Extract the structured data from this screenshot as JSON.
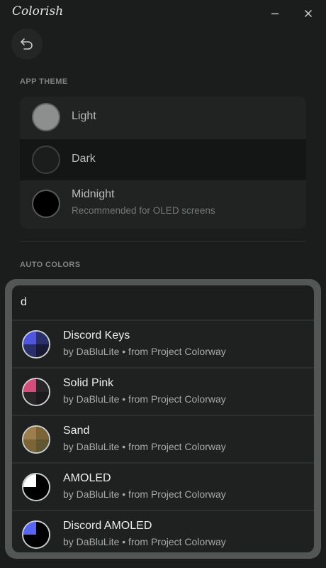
{
  "app": {
    "title": "Colorish",
    "minimize_icon": "minimize-icon",
    "close_icon": "close-icon",
    "back_icon": "undo-arrow-icon"
  },
  "sections": {
    "app_theme_label": "APP THEME",
    "auto_colors_label": "AUTO COLORS"
  },
  "themes": [
    {
      "name": "Light",
      "subtitle": "",
      "swatch": "#8d8f8e",
      "selected": false
    },
    {
      "name": "Dark",
      "subtitle": "",
      "swatch": "#1b1d1c",
      "selected": true
    },
    {
      "name": "Midnight",
      "subtitle": "Recommended for OLED screens",
      "swatch": "#000000",
      "selected": false
    }
  ],
  "search": {
    "value": "d"
  },
  "colorways": [
    {
      "name": "Discord Keys",
      "author": "by DaBluLite • from Project Colorway",
      "colors": [
        "#4e55e0",
        "#2a2f6b",
        "#2a2f6b",
        "#171936"
      ]
    },
    {
      "name": "Solid Pink",
      "author": "by DaBluLite • from Project Colorway",
      "colors": [
        "#d34d7d",
        "#2a2529",
        "#2a2529",
        "#1c1a1d"
      ]
    },
    {
      "name": "Sand",
      "author": "by DaBluLite • from Project Colorway",
      "colors": [
        "#9c7f4c",
        "#7c6436",
        "#7c6436",
        "#5f5731"
      ]
    },
    {
      "name": "AMOLED",
      "author": "by DaBluLite • from Project Colorway",
      "colors": [
        "#ffffff",
        "#000000",
        "#000000",
        "#000000"
      ]
    },
    {
      "name": "Discord AMOLED",
      "author": "by DaBluLite • from Project Colorway",
      "colors": [
        "#5865f2",
        "#000000",
        "#000000",
        "#000000"
      ]
    }
  ],
  "colors": {
    "background": "#1b1d1c",
    "popup_border": "#525755",
    "selected_row": "#141615"
  }
}
